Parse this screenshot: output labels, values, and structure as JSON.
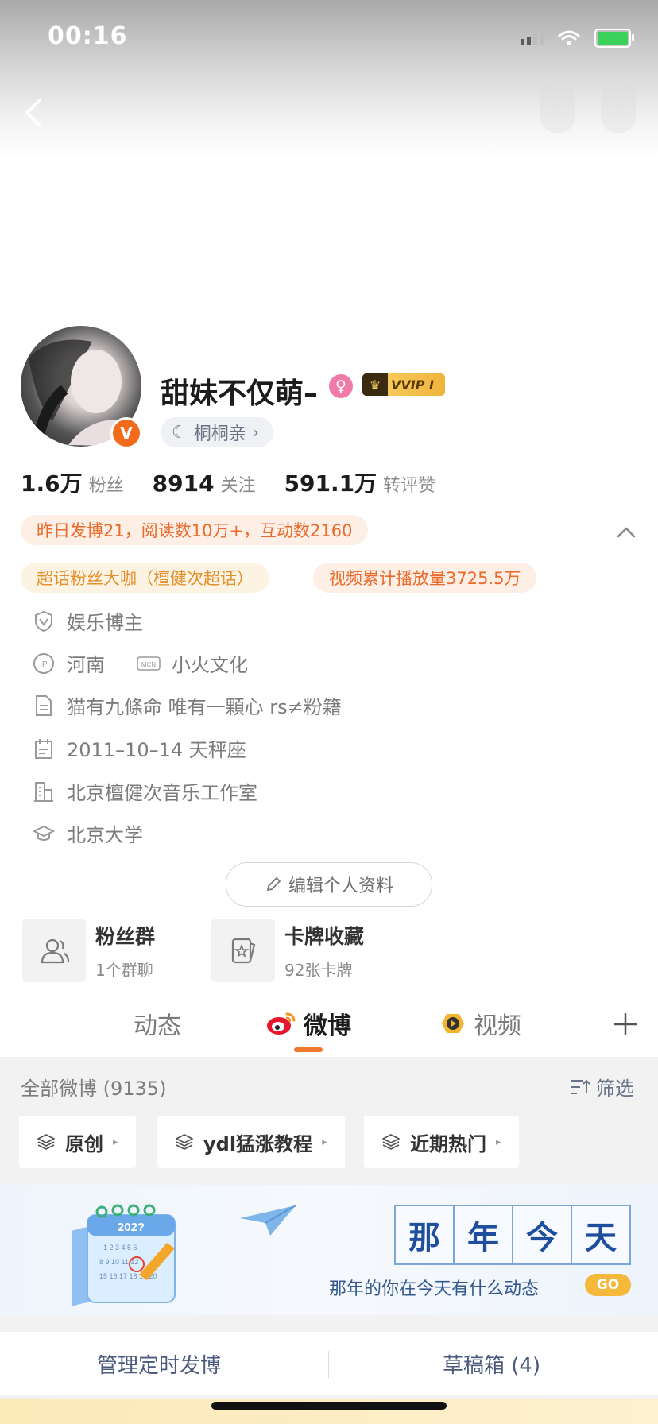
{
  "status_bar": {
    "time": "00:16"
  },
  "profile": {
    "name": "甜妹不仅萌–",
    "vip_label": "VVIP I",
    "nickname": "桐桐亲",
    "stats": [
      {
        "value": "1.6万",
        "label": "粉丝"
      },
      {
        "value": "8914",
        "label": "关注"
      },
      {
        "value": "591.1万",
        "label": "转评赞"
      }
    ],
    "highlight": "昨日发博21，阅读数10万+，互动数2160",
    "tags": [
      "超话粉丝大咖（檀健次超话）",
      "视频累计播放量3725.5万"
    ],
    "info": {
      "role": "娱乐博主",
      "ip": "河南",
      "mcn": "小火文化",
      "bio": "猫有九條命 唯有一顆心 rs≠粉籍",
      "birthday": "2011–10–14 天秤座",
      "company": "北京檀健次音乐工作室",
      "school": "北京大学"
    },
    "edit_button": "编辑个人资料"
  },
  "features": [
    {
      "title": "粉丝群",
      "subtitle": "1个群聊"
    },
    {
      "title": "卡牌收藏",
      "subtitle": "92张卡牌"
    }
  ],
  "tabs": {
    "feed": "动态",
    "weibo": "微博",
    "video": "视频"
  },
  "feed": {
    "title": "全部微博 (9135)",
    "filter_label": "筛选",
    "filters": [
      "原创",
      "ydl猛涨教程",
      "近期热门"
    ]
  },
  "banner": {
    "calendar_year": "202?",
    "title_chars": [
      "那",
      "年",
      "今",
      "天"
    ],
    "subtitle": "那年的你在今天有什么动态",
    "go_label": "GO"
  },
  "bottom": {
    "scheduled": "管理定时发博",
    "drafts": "草稿箱 (4)"
  },
  "colors": {
    "accent": "#ef7a2f",
    "link": "#6a7488",
    "vip_gold": "#f9d36a"
  }
}
